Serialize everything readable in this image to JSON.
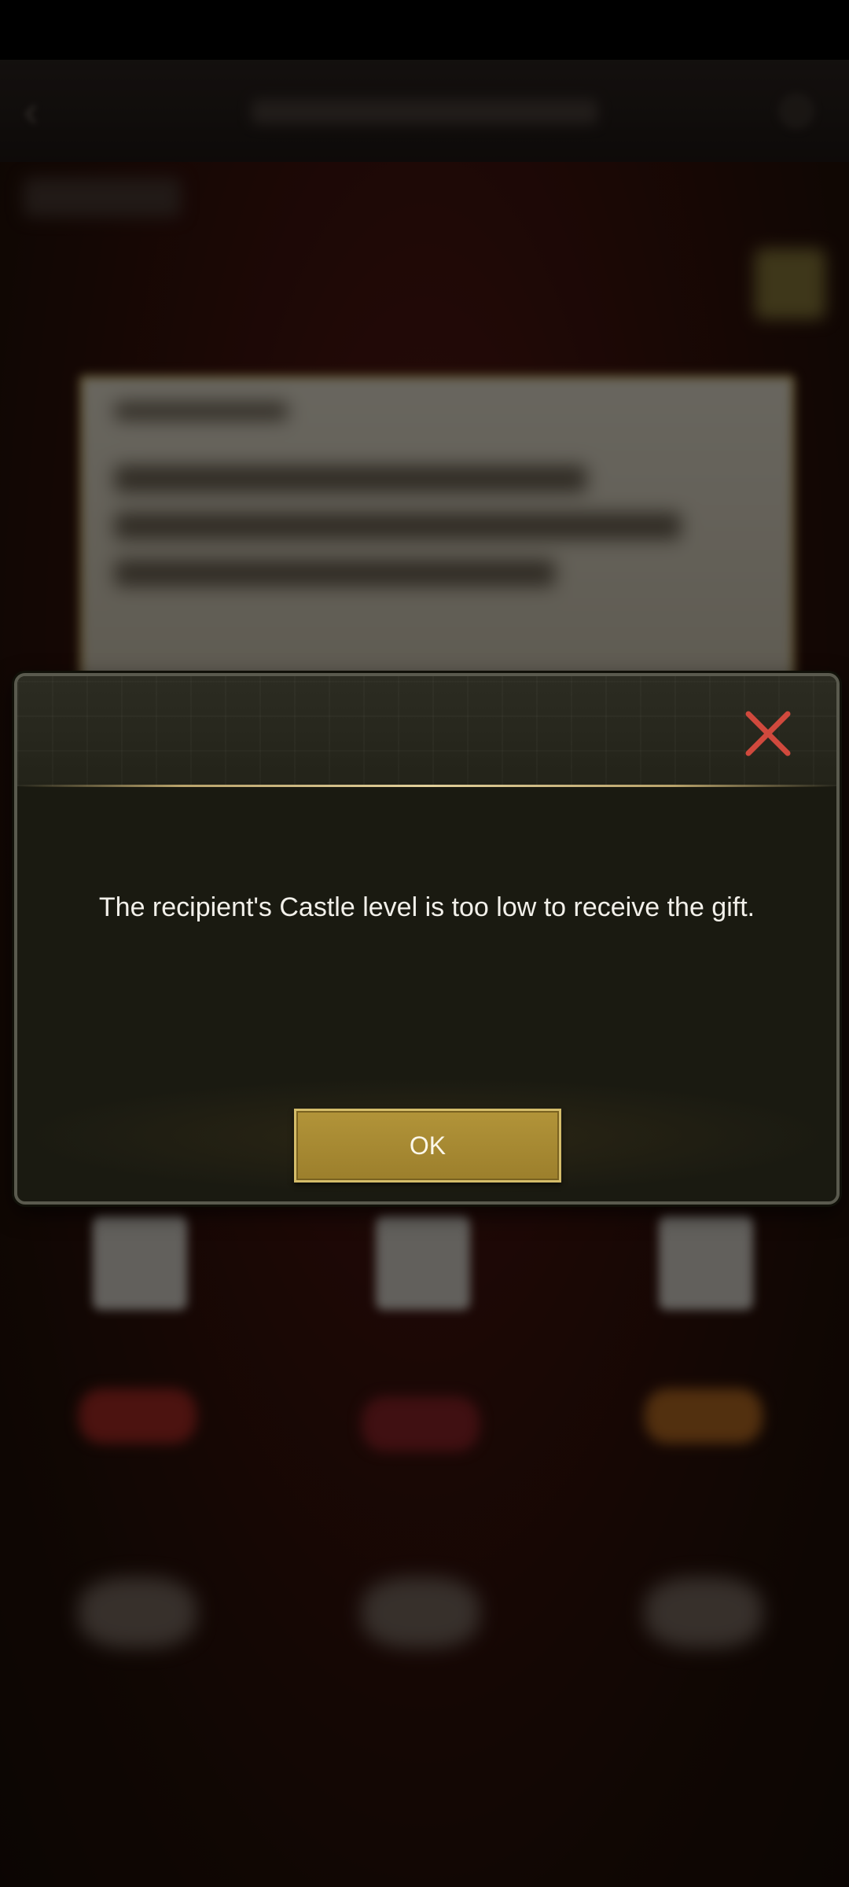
{
  "dialog": {
    "message": "The recipient's Castle level is too low to receive the gift.",
    "ok_label": "OK",
    "close_icon": "close-icon"
  },
  "colors": {
    "dialog_bg": "#1a1a11",
    "button_gold": "#b29439",
    "close_red": "#d0493d"
  }
}
